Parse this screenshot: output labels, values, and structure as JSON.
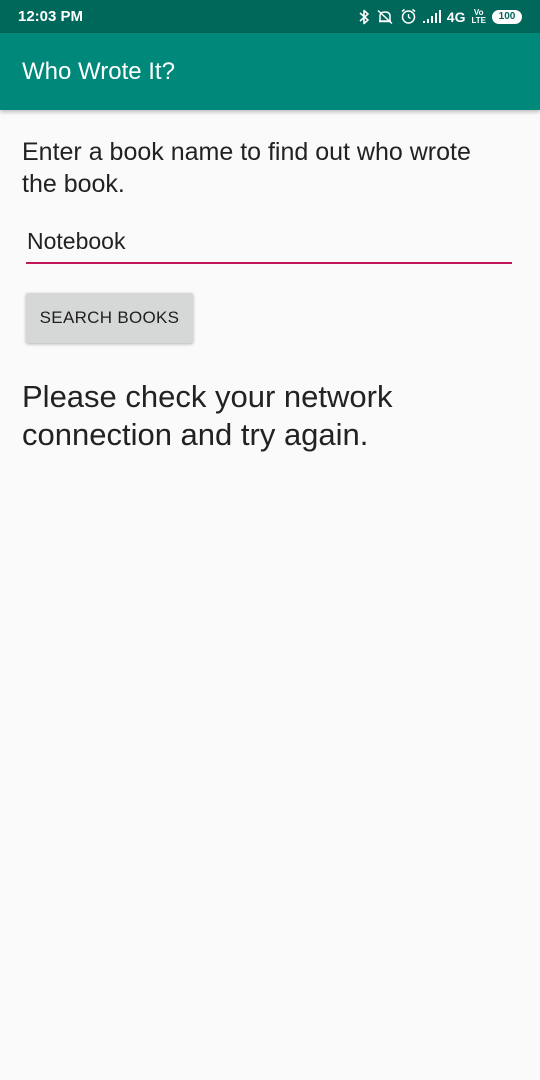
{
  "status_bar": {
    "time": "12:03 PM",
    "network": "4G",
    "volte_top": "Vo",
    "volte_bottom": "LTE",
    "battery": "100",
    "icons": [
      "bluetooth-icon",
      "muted-notification-icon",
      "alarm-icon",
      "signal-icon",
      "battery-icon"
    ]
  },
  "app_bar": {
    "title": "Who Wrote It?"
  },
  "main": {
    "prompt": "Enter a book name to find out who wrote the book.",
    "book_input_value": "Notebook",
    "search_button_label": "SEARCH BOOKS",
    "result_text": "Please check your network connection and try again."
  },
  "colors": {
    "status_bar": "#00675b",
    "app_bar": "#00897b",
    "input_underline": "#c2185b",
    "button_bg": "#d6d7d7",
    "background": "#fafafa"
  }
}
